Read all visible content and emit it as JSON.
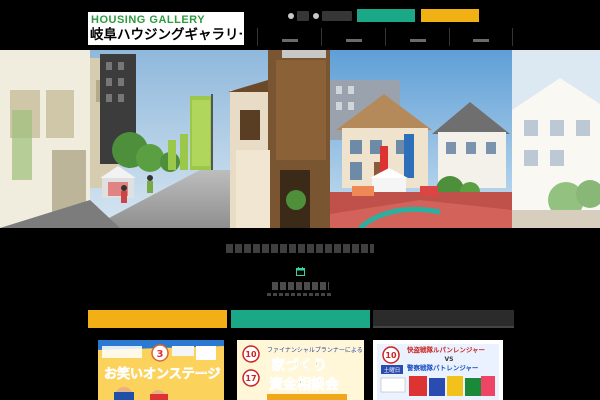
{
  "header": {
    "logo": {
      "brand_en": "HOUSING GALLERY",
      "brand_ja": "岐阜ハウジングギャラリー"
    },
    "utility_links": [
      {
        "label": ""
      },
      {
        "label": ""
      }
    ],
    "cta_buttons": [
      {
        "label": "",
        "color": "#1aa886"
      },
      {
        "label": "",
        "color": "#f1b014"
      }
    ],
    "global_nav": [
      {
        "label": ""
      },
      {
        "label": ""
      },
      {
        "label": ""
      },
      {
        "label": ""
      }
    ]
  },
  "hero": {
    "scenes": [
      "street-with-banners",
      "model-house-exhibition",
      "white-house"
    ]
  },
  "notice": {
    "text": "",
    "icon": "calendar-icon",
    "date": "",
    "date_sub": ""
  },
  "tabs": [
    {
      "label": "",
      "color": "#f3b016"
    },
    {
      "label": "",
      "color": "#1aa886"
    },
    {
      "label": "",
      "color": "#2b2b2b"
    }
  ],
  "event_cards": [
    {
      "date_circle_day": "3",
      "headline": "お笑いオンステージ",
      "tag": "",
      "theme": "#f6c24a"
    },
    {
      "date_circle_day": "10",
      "date_circle_day_2": "17",
      "top_line": "ファイナンシャルプランナーによる",
      "headline_1": "家づくり",
      "headline_2": "資金相談会",
      "theme": "#fbf1c2"
    },
    {
      "date_circle_day": "10",
      "tag": "土曜日",
      "headline_1": "快盗戦隊ルパンレンジャー",
      "headline_2": "VS",
      "headline_3": "警察戦隊パトレンジャー",
      "theme": "#e6f0ff"
    }
  ]
}
